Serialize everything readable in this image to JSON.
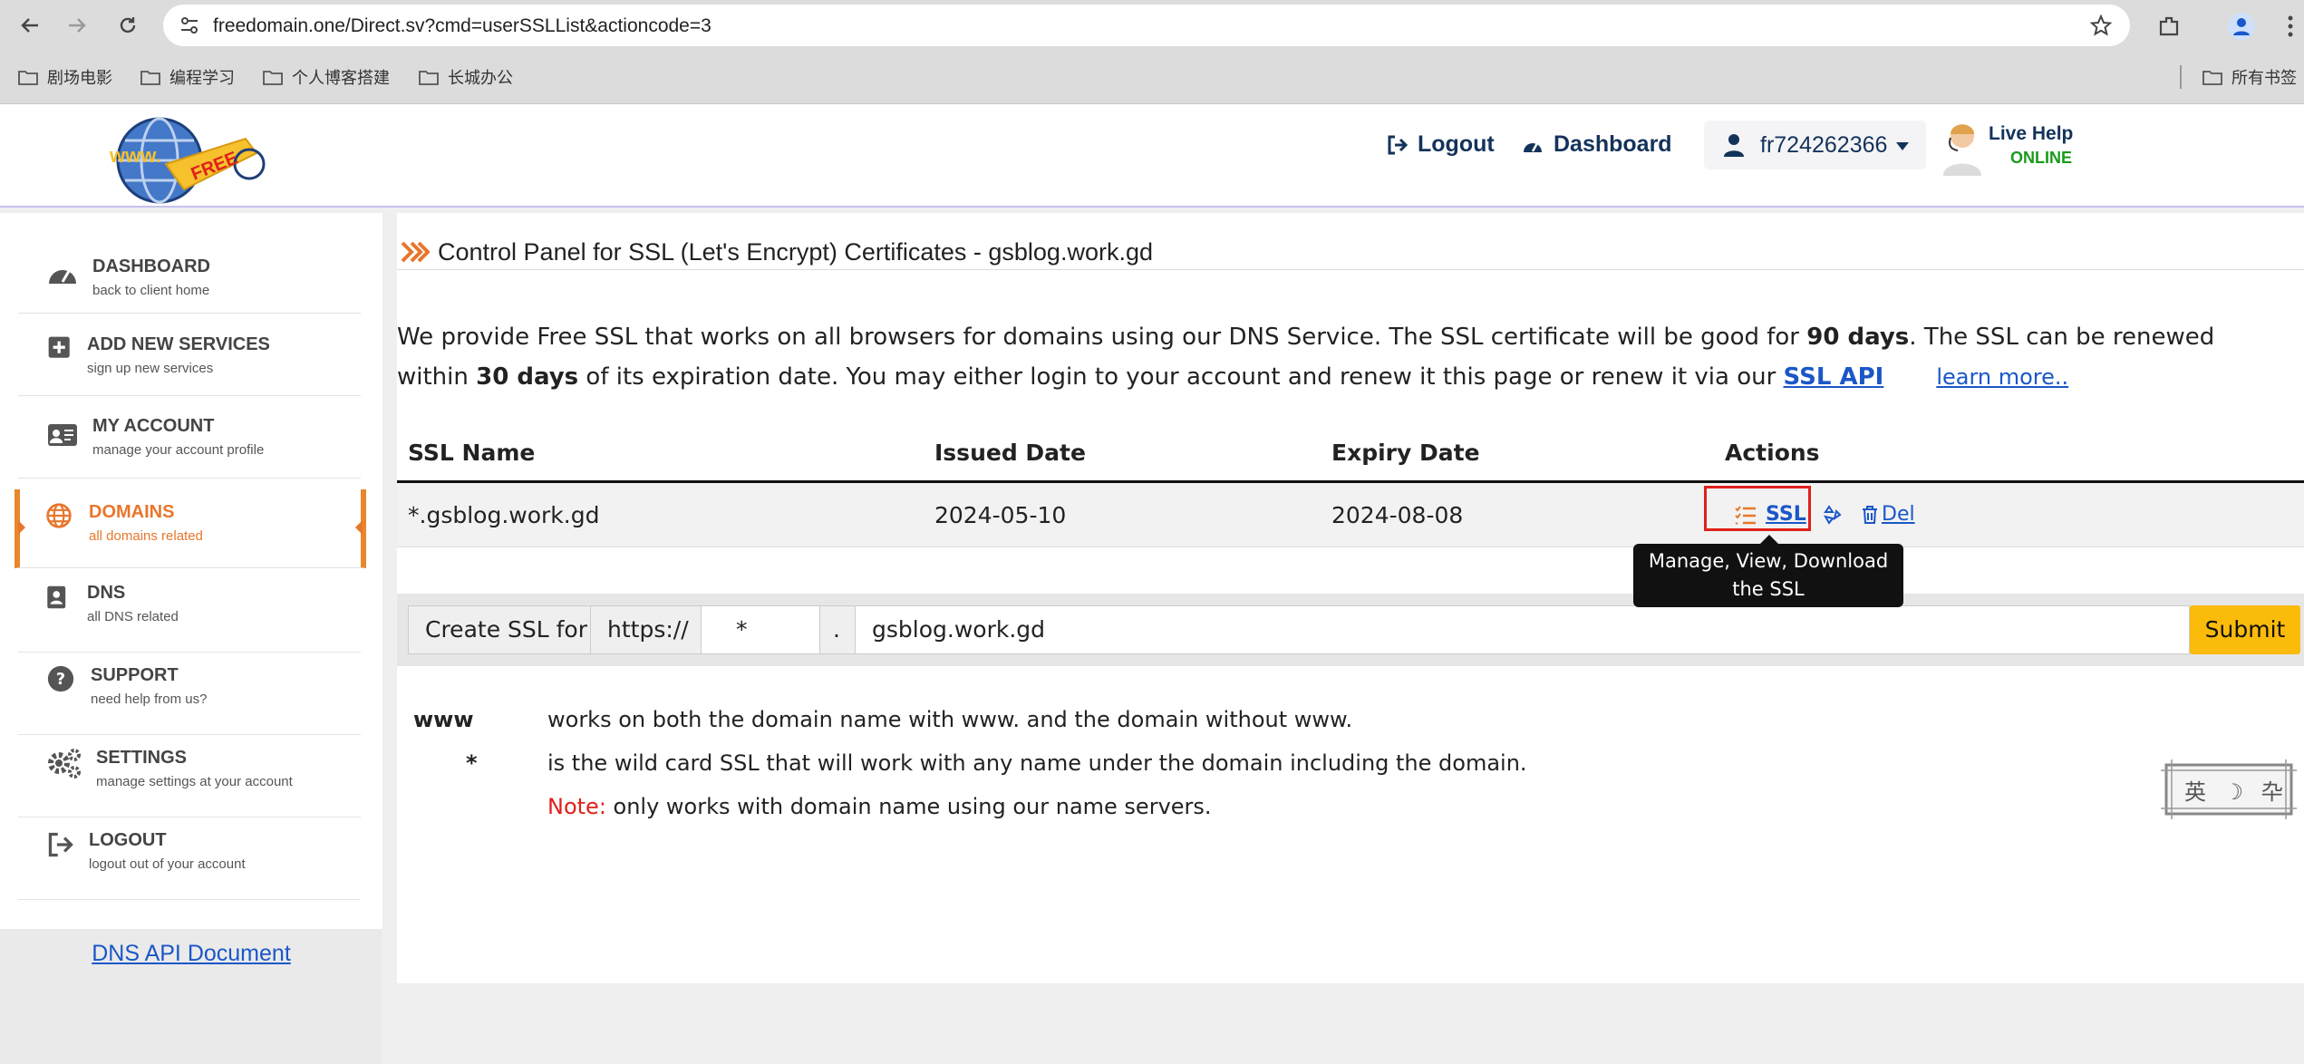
{
  "browser": {
    "url": "freedomain.one/Direct.sv?cmd=userSSLList&actioncode=3",
    "bookmarks": [
      "剧场电影",
      "编程学习",
      "个人博客搭建",
      "长城办公"
    ],
    "bookmarks_right": "所有书签"
  },
  "header": {
    "logout_label": "Logout",
    "dashboard_label": "Dashboard",
    "username": "fr724262366",
    "live_help": "Live Help",
    "live_status": "ONLINE",
    "logo_tag": "FREE",
    "logo_www": "www."
  },
  "sidebar": {
    "items": [
      {
        "title": "DASHBOARD",
        "subtitle": "back to client home",
        "icon": "dashboard-icon"
      },
      {
        "title": "ADD NEW SERVICES",
        "subtitle": "sign up new services",
        "icon": "plus-square-icon"
      },
      {
        "title": "MY ACCOUNT",
        "subtitle": "manage your account profile",
        "icon": "id-card-icon"
      },
      {
        "title": "DOMAINS",
        "subtitle": "all domains related",
        "icon": "globe-icon",
        "active": true
      },
      {
        "title": "DNS",
        "subtitle": "all DNS related",
        "icon": "address-book-icon"
      },
      {
        "title": "SUPPORT",
        "subtitle": "need help from us?",
        "icon": "question-circle-icon"
      },
      {
        "title": "SETTINGS",
        "subtitle": "manage settings at your account",
        "icon": "gears-icon"
      },
      {
        "title": "LOGOUT",
        "subtitle": "logout out of your account",
        "icon": "sign-out-icon"
      }
    ],
    "dns_api_link": "DNS API Document"
  },
  "main": {
    "title": "Control Panel for SSL (Let's Encrypt) Certificates - gsblog.work.gd",
    "intro": {
      "p1": "We provide Free SSL that works on all browsers for domains using our DNS Service. The SSL certificate will be good for ",
      "b1": "90 days",
      "p2": ". The SSL can be renewed within ",
      "b2": "30 days",
      "p3": " of its expiration date. You may either login to your account and renew it this page or renew it via our ",
      "api_link": "SSL API",
      "learn_more": "learn more.."
    },
    "table": {
      "headers": [
        "SSL Name",
        "Issued Date",
        "Expiry Date",
        "Actions"
      ],
      "rows": [
        {
          "name": "*.gsblog.work.gd",
          "issued": "2024-05-10",
          "expiry": "2024-08-08",
          "ssl_action": "SSL",
          "del_action": "Del"
        }
      ]
    },
    "tooltip": "Manage, View, Download the SSL",
    "create_form": {
      "label": "Create SSL for",
      "protocol": "https://",
      "subdomain": "*",
      "dot": ".",
      "domain": "gsblog.work.gd",
      "submit": "Submit"
    },
    "legend": {
      "www_key": "www",
      "www_text": "works on both the domain name with www. and the domain without www.",
      "star_key": "*",
      "star_text": "is the wild card SSL that will work with any name under the domain including the domain.",
      "note_label": "Note:",
      "note_text": " only works with domain name using our name servers."
    },
    "stamp": "英 ☽ 卆"
  },
  "colors": {
    "accent": "#e8762c",
    "link": "#1a57c8",
    "submit": "#fbbb0b",
    "highlight_box": "#e0201a"
  }
}
